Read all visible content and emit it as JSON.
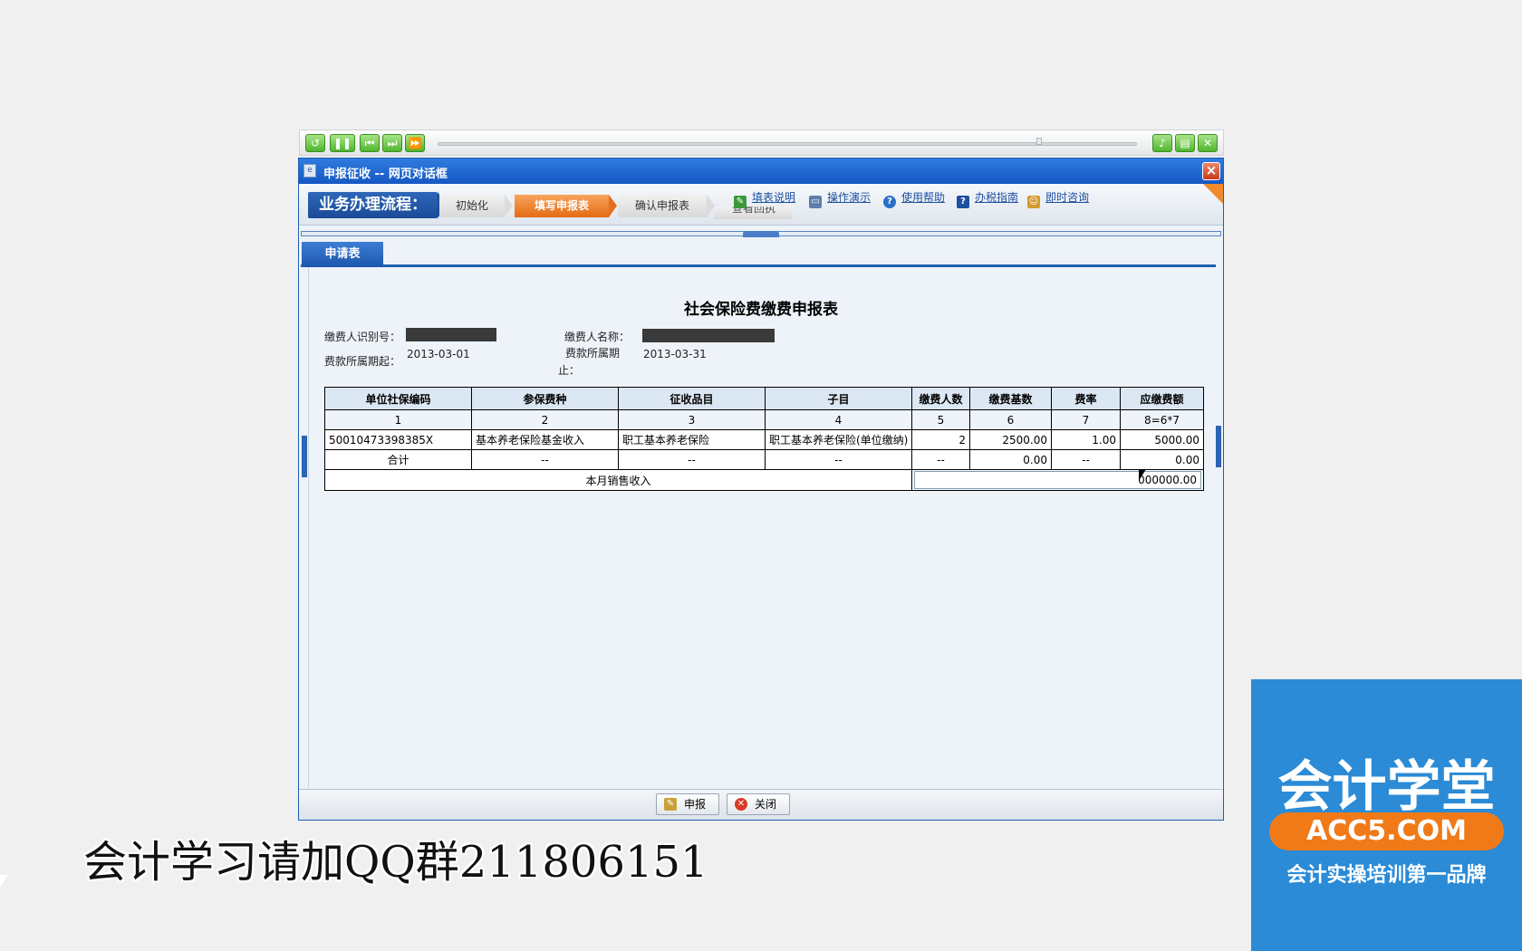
{
  "dialog": {
    "title": "申报征收 -- 网页对话框",
    "process_label": "业务办理流程：",
    "steps": [
      "初始化",
      "填写申报表",
      "确认申报表",
      "查看回执"
    ],
    "links": [
      "填表说明",
      "操作演示",
      "使用帮助",
      "办税指南",
      "即时咨询"
    ],
    "tab": "申请表"
  },
  "form": {
    "title": "社会保险费缴费申报表",
    "payer_id_label": "缴费人识别号：",
    "payer_name_label": "缴费人名称：",
    "period_start_label": "费款所属期起：",
    "period_start": "2013-03-01",
    "period_end_label_1": "费款所属期",
    "period_end_label_2": "止：",
    "period_end": "2013-03-31"
  },
  "table": {
    "headers": [
      "单位社保编码",
      "参保费种",
      "征收品目",
      "子目",
      "缴费人数",
      "缴费基数",
      "费率",
      "应缴费额"
    ],
    "indices": [
      "1",
      "2",
      "3",
      "4",
      "5",
      "6",
      "7",
      "8=6*7"
    ],
    "row": [
      "50010473398385X",
      "基本养老保险基金收入",
      "职工基本养老保险",
      "职工基本养老保险(单位缴纳)",
      "2",
      "2500.00",
      "1.00",
      "5000.00"
    ],
    "total": [
      "合计",
      "--",
      "--",
      "--",
      "--",
      "0.00",
      "--",
      "0.00"
    ],
    "sales_label": "本月销售收入",
    "sales_value": "000000.00"
  },
  "footer": {
    "submit": "申报",
    "close": "关闭"
  },
  "overlay": {
    "qq_text": "会计学习请加QQ群211806151",
    "brand_title": "会计学堂",
    "brand_url": "ACC5.COM",
    "brand_sub": "会计实操培训第一品牌"
  },
  "colors": {
    "titlebar": "#1f66cf",
    "accent": "#e56f1a",
    "brand": "#2b8bd6"
  }
}
